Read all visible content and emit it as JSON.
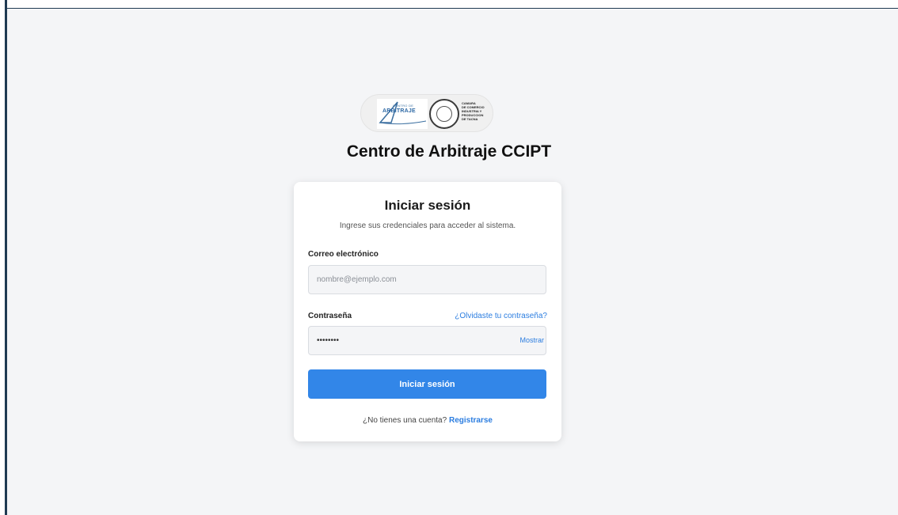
{
  "logo": {
    "left_small_text": "CENTRO DE",
    "left_big_text": "ARBITRAJE",
    "right_text": "CAMARA\nDE COMERCIO\nINDUSTRIA Y\nPRODUCCION\nDE TACNA"
  },
  "site_title": "Centro de Arbitraje CCIPT",
  "login": {
    "title": "Iniciar sesión",
    "subtitle": "Ingrese sus credenciales para acceder al sistema.",
    "email_label": "Correo electrónico",
    "email_placeholder": "nombre@ejemplo.com",
    "password_label": "Contraseña",
    "password_value": "••••••••",
    "forgot_link": "¿Olvidaste tu contraseña?",
    "show_toggle": "Mostrar",
    "submit_label": "Iniciar sesión",
    "register_prompt": "¿No tienes una cuenta?",
    "register_link": "Registrarse"
  },
  "colors": {
    "accent": "#3286e8",
    "link": "#2b7de0",
    "background": "#f4f5f7",
    "frame_border": "#1f3a52"
  }
}
